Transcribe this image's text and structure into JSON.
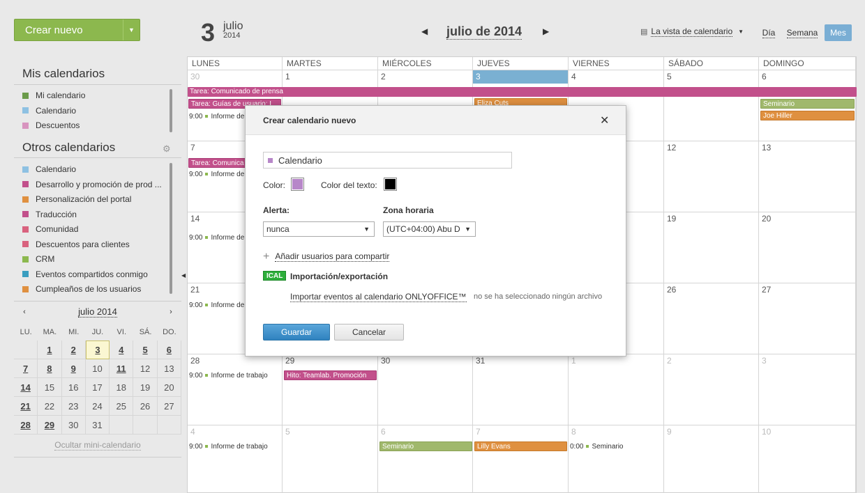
{
  "sidebar": {
    "create_label": "Crear nuevo",
    "my_title": "Mis calendarios",
    "my_items": [
      {
        "label": "Mi calendario",
        "color": "#6b9b4a"
      },
      {
        "label": "Calendario",
        "color": "#8ec1e2"
      },
      {
        "label": "Descuentos",
        "color": "#d894bf"
      }
    ],
    "other_title": "Otros calendarios",
    "other_items": [
      {
        "label": "Calendario",
        "color": "#8ec1e2"
      },
      {
        "label": "Desarrollo y promoción de prod ...",
        "color": "#c2508b"
      },
      {
        "label": "Personalización del portal",
        "color": "#df9040"
      },
      {
        "label": "Traducción",
        "color": "#c2508b"
      },
      {
        "label": "Comunidad",
        "color": "#d9627e"
      },
      {
        "label": "Descuentos para clientes",
        "color": "#d9627e"
      },
      {
        "label": "CRM",
        "color": "#8cb84e"
      },
      {
        "label": "Eventos compartidos conmigo",
        "color": "#3a9ec0"
      },
      {
        "label": "Cumpleaños de los usuarios",
        "color": "#df9040"
      }
    ]
  },
  "mini": {
    "title": "julio 2014",
    "prev": "‹",
    "next": "›",
    "day_headers": [
      "LU.",
      "MA.",
      "MI.",
      "JU.",
      "VI.",
      "SÁ.",
      "DO."
    ],
    "hide_label": "Ocultar mini-calendario"
  },
  "header": {
    "day_big": "3",
    "month": "julio",
    "year": "2014",
    "nav_title": "julio de 2014",
    "prev": "◀",
    "next": "▶",
    "view_label": "La vista de calendario",
    "btn_day": "Día",
    "btn_week": "Semana",
    "btn_month": "Mes"
  },
  "grid": {
    "headers": [
      "LUNES",
      "MARTES",
      "MIÉRCOLES",
      "JUEVES",
      "VIERNES",
      "SÁBADO",
      "DOMINGO"
    ],
    "weeks": [
      [
        "30",
        "1",
        "2",
        "3",
        "4",
        "5",
        "6"
      ],
      [
        "7",
        "",
        "",
        "",
        "",
        "12",
        "13"
      ],
      [
        "14",
        "",
        "",
        "",
        "",
        "19",
        "20"
      ],
      [
        "21",
        "",
        "",
        "",
        "",
        "26",
        "27"
      ],
      [
        "28",
        "29",
        "30",
        "31",
        "1",
        "2",
        "3"
      ],
      [
        "4",
        "5",
        "6",
        "7",
        "8",
        "9",
        "10"
      ]
    ],
    "events": {
      "press": "Tarea: Comunicado de prensa",
      "guides": "Tarea: Guías de usuario: I",
      "eliza": "Eliza Cuts",
      "seminar1": "Seminario",
      "joe": "Joe Hiller",
      "report1": "9:00",
      "report_label": "Informe de",
      "comm2": "Tarea: Comunica",
      "report2": "9:00",
      "report3": "9:00",
      "report4": "9:00",
      "report5": "9:00",
      "report5_label": "Informe de trabajo",
      "hito": "Hito: Teamlab. Promoción",
      "report6": "9:00",
      "report6_label": "Informe de trabajo",
      "seminar2": "Seminario",
      "lilly": "Lilly Evans",
      "seminar3_time": "0:00",
      "seminar3": "Seminario"
    }
  },
  "dialog": {
    "title": "Crear calendario nuevo",
    "close": "✕",
    "name_value": "Calendario",
    "color_label": "Color:",
    "color_value": "#b787c9",
    "text_color_label": "Color del texto:",
    "text_color_value": "#000000",
    "alert_label": "Alerta:",
    "alert_value": "nunca",
    "tz_label": "Zona horaria",
    "tz_value": "(UTC+04:00) Abu D",
    "share_label": "Añadir usuarios para compartir",
    "ical_badge": "ICAL",
    "ical_title": "Importación/exportación",
    "import_label": "Importar eventos al calendario ONLYOFFICE™",
    "no_file": "no se ha seleccionado ningún archivo",
    "save": "Guardar",
    "cancel": "Cancelar"
  }
}
